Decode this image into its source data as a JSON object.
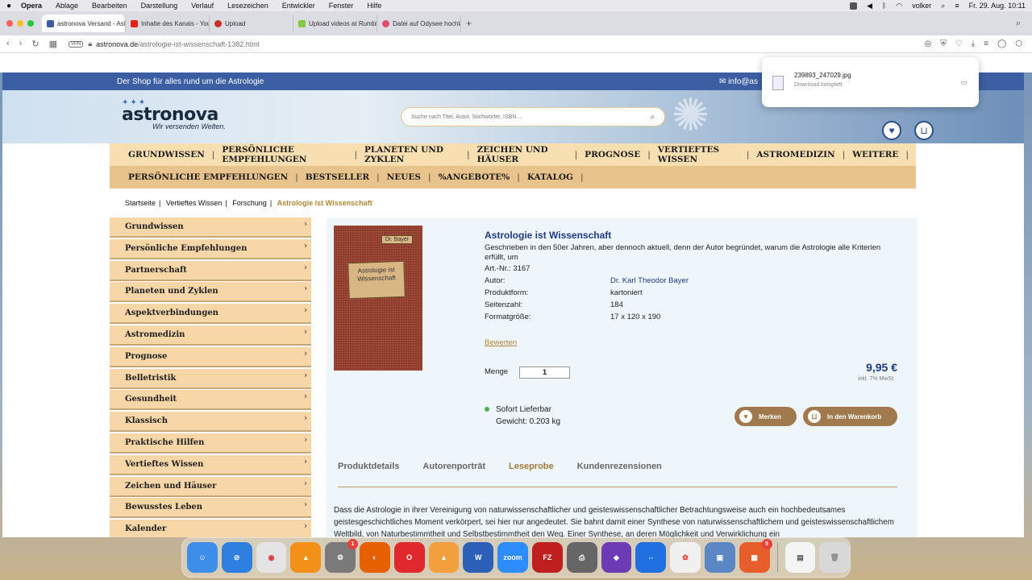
{
  "menubar": {
    "app": "Opera",
    "items": [
      "Ablage",
      "Bearbeiten",
      "Darstellung",
      "Verlauf",
      "Lesezeichen",
      "Entwickler",
      "Fenster",
      "Hilfe"
    ],
    "user": "volker",
    "datetime": "Fr. 29. Aug.  10:11"
  },
  "tabs": [
    {
      "label": "astronova Versand - Astr",
      "color": "#3c5fa3"
    },
    {
      "label": "Inhalte des Kanals - You",
      "color": "#e62117"
    },
    {
      "label": "Upload",
      "color": "#c9302c"
    },
    {
      "label": "Upload videos at Rumble",
      "color": "#85c742"
    },
    {
      "label": "Datei auf Odysee hochla",
      "color": "#e54b6b"
    }
  ],
  "address": {
    "domain": "astronova.de",
    "path": "/astrologie-ist-wissenschaft-1382.html",
    "vpn": "VPN"
  },
  "download": {
    "filename": "239893_247029.jpg",
    "status": "Download komplett"
  },
  "site": {
    "tagline": "Der Shop für alles rund um die Astrologie",
    "mail": "info@as",
    "logo": "astronova",
    "slogan": "Wir versenden Welten.",
    "search_placeholder": "Suche nach Titel, Autor, Stichwörter, ISBN ..."
  },
  "nav1": [
    "GRUNDWISSEN",
    "PERSÖNLICHE EMPFEHLUNGEN",
    "PLANETEN UND ZYKLEN",
    "ZEICHEN UND HÄUSER",
    "PROGNOSE",
    "VERTIEFTES WISSEN",
    "ASTROMEDIZIN",
    "WEITERE"
  ],
  "nav2": [
    "PERSÖNLICHE EMPFEHLUNGEN",
    "BESTSELLER",
    "NEUES",
    "%ANGEBOTE%",
    "KATALOG"
  ],
  "breadcrumb": [
    "Startseite",
    "Vertieftes Wissen",
    "Forschung",
    "Astrologie ist Wissenschaft"
  ],
  "sidebar": [
    "Grundwissen",
    "Persönliche Empfehlungen",
    "Partnerschaft",
    "Planeten und Zyklen",
    "Aspektverbindungen",
    "Astromedizin",
    "Prognose",
    "Belletristik",
    "Gesundheit",
    "Klassisch",
    "Praktische Hilfen",
    "Vertieftes Wissen",
    "Zeichen und Häuser",
    "Bewusstes Leben",
    "Kalender"
  ],
  "product": {
    "cover_tag": "Dr. Bayer",
    "cover_title": "Astrologie ist Wissenschaft",
    "title": "Astrologie ist Wissenschaft",
    "description": "Geschrieben in den 50er Jahren, aber dennoch aktuell, denn der Autor begründet, warum die Astrologie alle Kriterien erfüllt, um",
    "art_nr": "Art.-Nr.: 3167",
    "specs": [
      {
        "k": "Autor:",
        "v": "Dr. Karl Theodor Bayer"
      },
      {
        "k": "Produktform:",
        "v": "kartoniert"
      },
      {
        "k": "Seitenzahl:",
        "v": "184"
      },
      {
        "k": "Formatgröße:",
        "v": "17 x 120 x 190"
      }
    ],
    "rate": "Bewerten",
    "qty_label": "Menge",
    "qty": "1",
    "price": "9,95 €",
    "tax": "inkl. 7% MwSt.",
    "availability": "Sofort Lieferbar",
    "weight": "Gewicht: 0.203 kg",
    "merken": "Merken",
    "cart": "In den Warenkorb",
    "tabs": [
      "Produktdetails",
      "Autorenporträt",
      "Leseprobe",
      "Kundenrezensionen"
    ],
    "text": "Dass die Astrologie in ihrer Vereinigung von naturwissenschaftlicher und geisteswissenschaftlicher Betrachtungsweise auch ein hochbedeutsames geistesgeschichtliches Moment verkörpert, sei hier nur angedeutet. Sie bahnt damit einer Synthese von naturwissenschaftlichem und geisteswissenschaftlichem Weltbild, von Naturbestimmtheit und Selbstbestimmtheit den Weg. Einer Synthese, an deren Möglichkeit und Verwirklichung ein"
  },
  "dock": [
    {
      "name": "finder",
      "color": "#3d8ee8",
      "badge": ""
    },
    {
      "name": "safari",
      "color": "#2f7fe0",
      "badge": ""
    },
    {
      "name": "chrome",
      "color": "#e4e4e4",
      "badge": ""
    },
    {
      "name": "vlc-cone",
      "color": "#f29018",
      "badge": ""
    },
    {
      "name": "system-settings",
      "color": "#7a7a7a",
      "badge": "1"
    },
    {
      "name": "firefox",
      "color": "#e66000",
      "badge": ""
    },
    {
      "name": "opera",
      "color": "#e0292e",
      "badge": ""
    },
    {
      "name": "vlc",
      "color": "#f2a03d",
      "badge": ""
    },
    {
      "name": "word",
      "color": "#2b5fb8",
      "badge": ""
    },
    {
      "name": "zoom",
      "color": "#2d8cff",
      "badge": ""
    },
    {
      "name": "filezilla",
      "color": "#bf1f1f",
      "badge": ""
    },
    {
      "name": "printer",
      "color": "#666666",
      "badge": ""
    },
    {
      "name": "affinity",
      "color": "#6c3bb5",
      "badge": ""
    },
    {
      "name": "teamviewer",
      "color": "#1f6fe0",
      "badge": ""
    },
    {
      "name": "photos",
      "color": "#f0f0f0",
      "badge": ""
    },
    {
      "name": "preview",
      "color": "#5b87c4",
      "badge": ""
    },
    {
      "name": "app-store",
      "color": "#e85d2c",
      "badge": "5"
    },
    {
      "name": "downloads",
      "color": "#f4f4f4",
      "badge": ""
    },
    {
      "name": "trash",
      "color": "#d8d8d8",
      "badge": ""
    }
  ],
  "dock_labels": {
    "word": "W",
    "zoom": "zoom",
    "filezilla": "FZ"
  }
}
